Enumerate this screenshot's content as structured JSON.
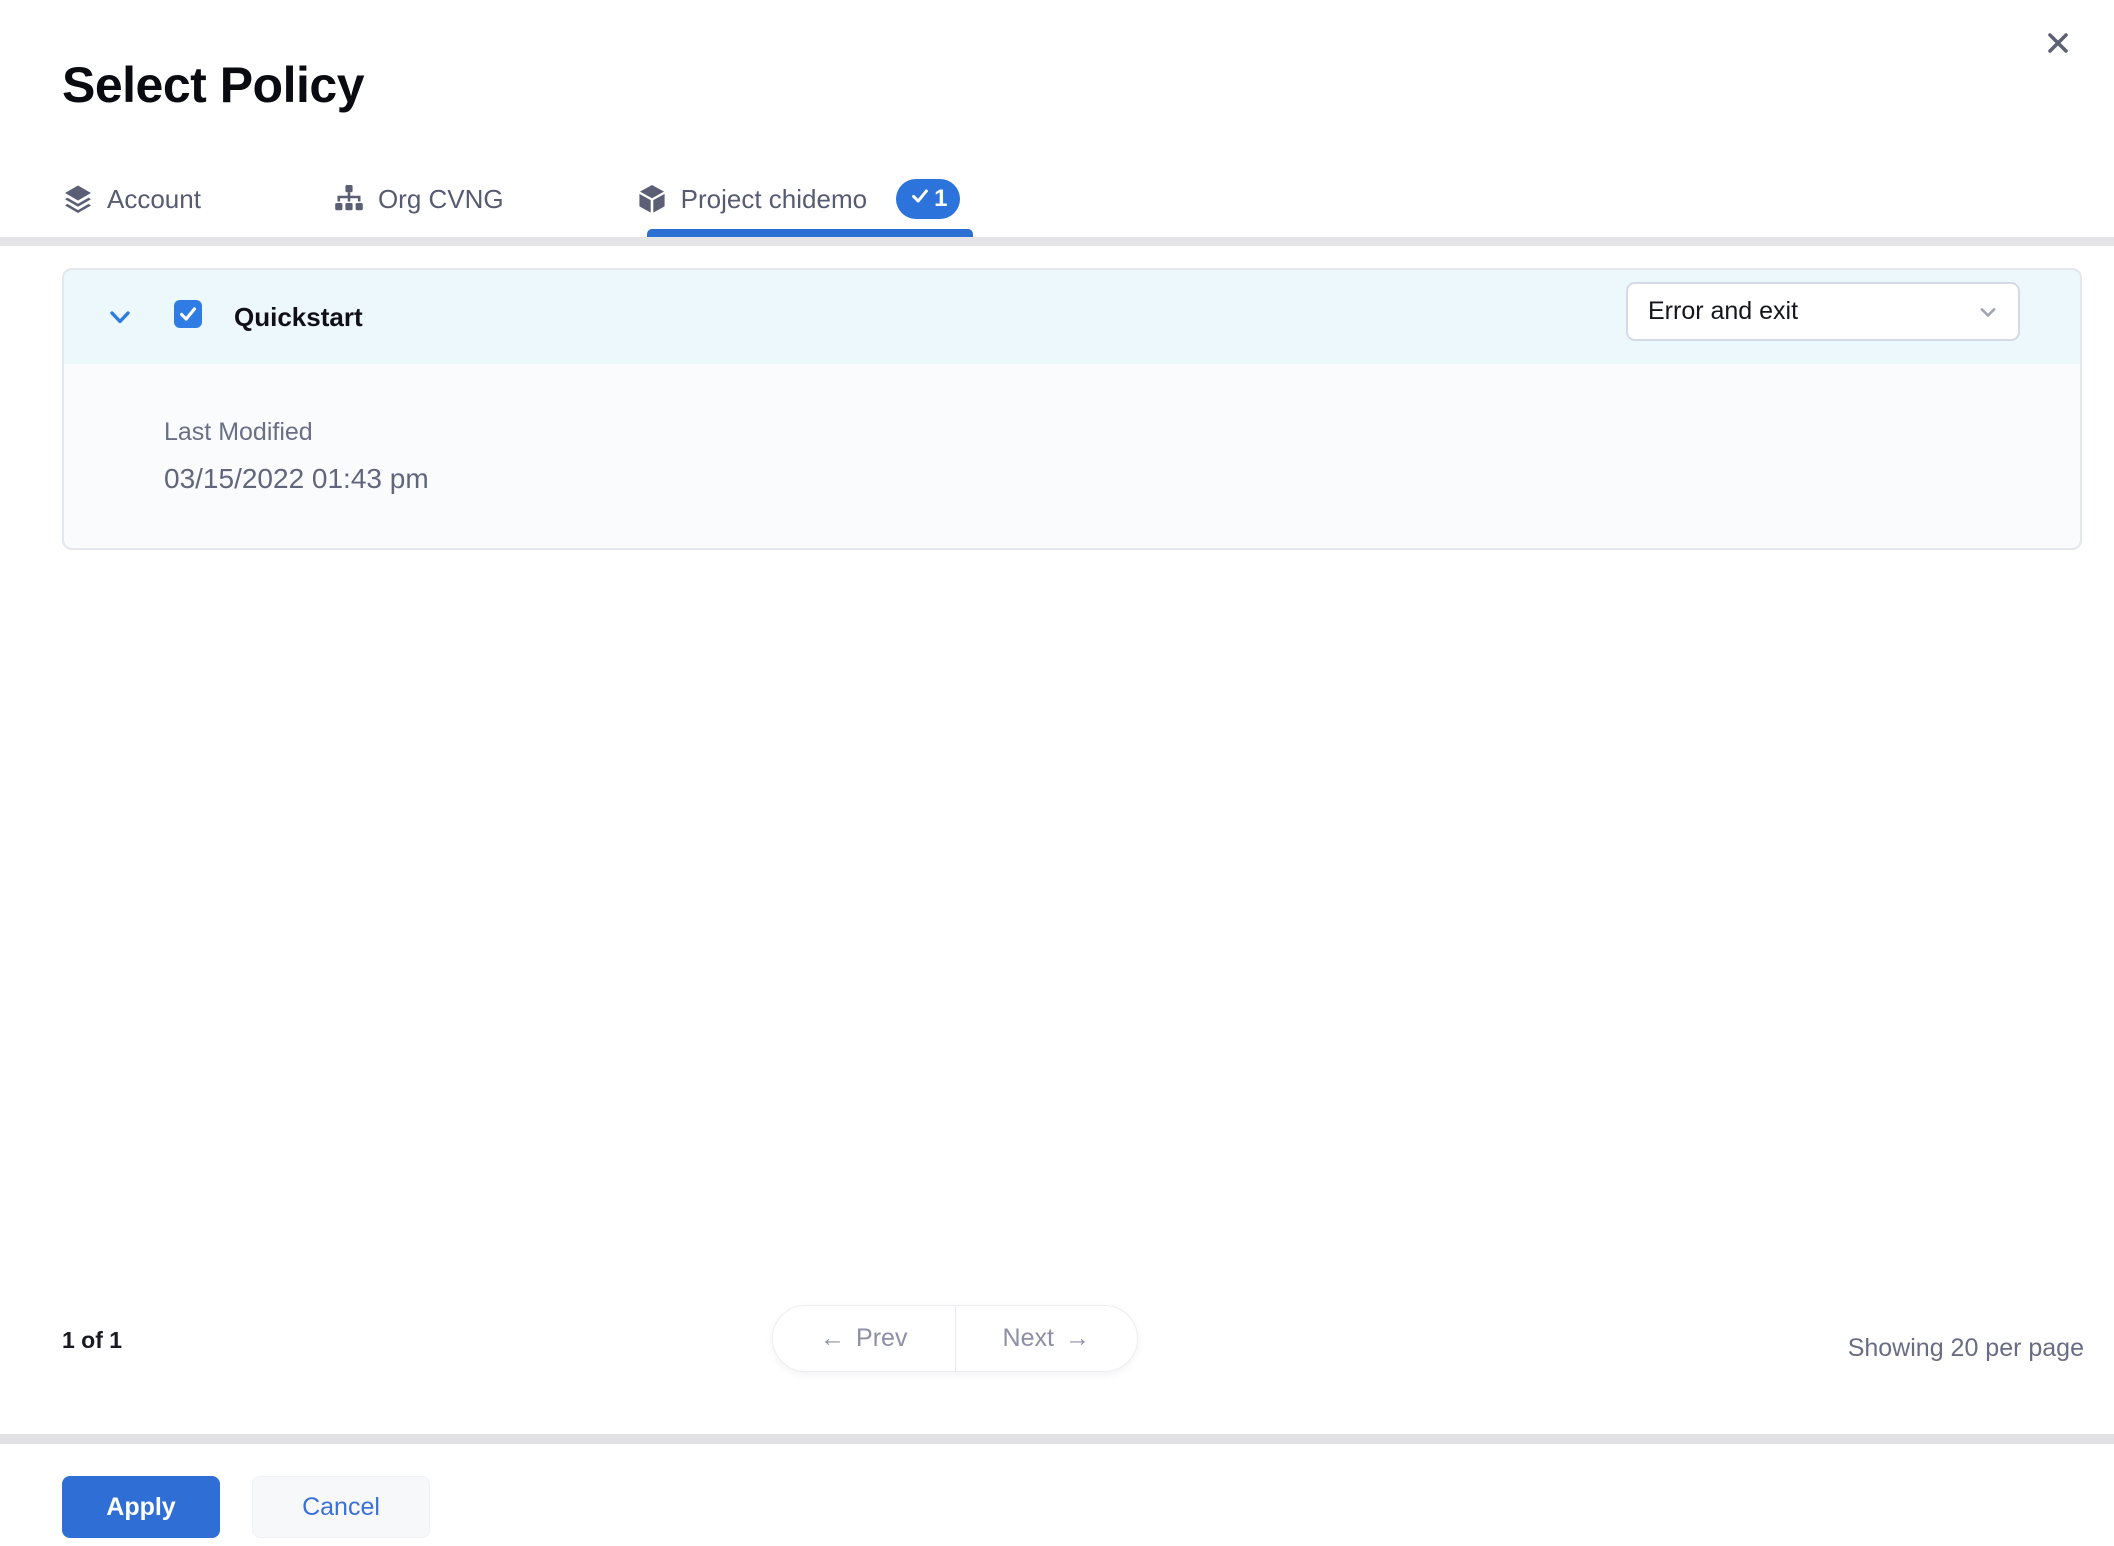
{
  "dialog": {
    "title": "Select Policy"
  },
  "tabs": [
    {
      "label": "Account",
      "icon": "layers-icon",
      "active": false
    },
    {
      "label": "Org CVNG",
      "icon": "org-chart-icon",
      "active": false
    },
    {
      "label": "Project chidemo",
      "icon": "cube-icon",
      "active": true,
      "badge_count": "1"
    }
  ],
  "policy_list": {
    "rows": [
      {
        "name": "Quickstart",
        "checked": true,
        "expanded": true,
        "severity_select": {
          "value": "Error and exit"
        },
        "details": {
          "last_modified_label": "Last Modified",
          "last_modified_value": "03/15/2022 01:43 pm"
        }
      }
    ]
  },
  "pagination": {
    "page_info": "1 of 1",
    "prev_arrow": "←",
    "prev_label": "Prev",
    "next_label": "Next",
    "next_arrow": "→",
    "showing": "Showing 20 per page"
  },
  "footer": {
    "apply_label": "Apply",
    "cancel_label": "Cancel"
  },
  "colors": {
    "accent_blue": "#2f6fd5",
    "checkbox_blue": "#2e7ce4",
    "badge_blue": "#2c73dc",
    "selected_row_bg": "#edf8fd",
    "divider_gray": "#e4e4e7",
    "muted_text": "#696d84"
  }
}
